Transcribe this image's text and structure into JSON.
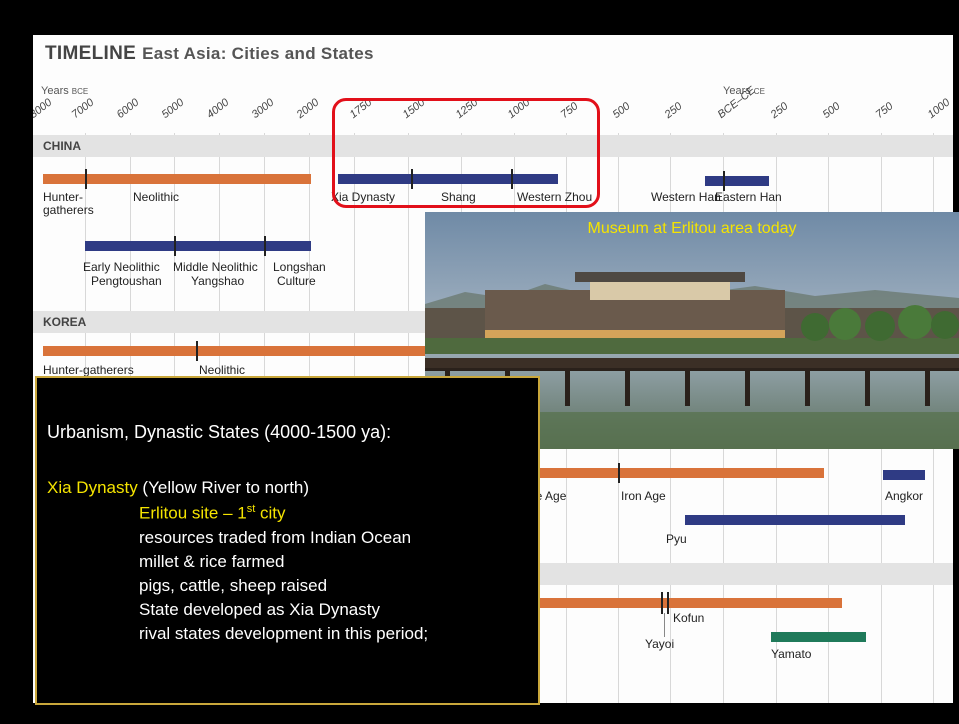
{
  "timeline": {
    "title_main": "TIMELINE",
    "title_sub": "East Asia: Cities and States",
    "years_bce_label": "Years",
    "years_bce_unit": "BCE",
    "years_ce_label": "Years",
    "years_ce_unit": "CE",
    "ticks": [
      "8000",
      "7000",
      "6000",
      "5000",
      "4000",
      "3000",
      "2000",
      "1750",
      "1500",
      "1250",
      "1000",
      "750",
      "500",
      "250",
      "BCE–CE",
      "250",
      "500",
      "750",
      "1000"
    ],
    "regions": {
      "china": "CHINA",
      "korea": "KOREA"
    },
    "labels": {
      "hunter_gatherers": "Hunter-",
      "hunter_gatherers2": "gatherers",
      "neolithic": "Neolithic",
      "xia": "Xia Dynasty",
      "shang": "Shang",
      "western_zhou": "Western Zhou",
      "western_han": "Western Han",
      "eastern_han": "Eastern Han",
      "early_neolithic": "Early Neolithic",
      "pengtoushan": "Pengtoushan",
      "middle_neolithic": "Middle Neolithic",
      "yangshao": "Yangshao",
      "longshan": "Longshan",
      "culture": "Culture",
      "korea_hunter": "Hunter-gatherers",
      "korea_neolithic": "Neolithic",
      "bronze_age": "nze Age",
      "iron_age": "Iron Age",
      "angkor": "Angkor",
      "pyu": "Pyu",
      "kofun": "Kofun",
      "yayoi": "Yayoi",
      "yamato": "Yamato"
    }
  },
  "photo": {
    "caption": "Museum at Erlitou area today"
  },
  "info": {
    "heading": "Urbanism, Dynastic States (4000-1500 ya):",
    "xia": "Xia Dynasty",
    "xia_rest": " (Yellow River to north)",
    "erlitou": "Erlitou site – 1",
    "erlitou_sup": "st",
    "erlitou_end": " city",
    "lines": [
      "resources traded from Indian Ocean",
      "millet & rice farmed",
      "pigs, cattle, sheep raised",
      "State developed as Xia Dynasty",
      "rival states development in this period;"
    ]
  },
  "colors": {
    "orange": "#d9733a",
    "blue": "#2f3b84",
    "green": "#1f7a5a",
    "highlight": "#e2101a",
    "caption_yellow": "#f5e400",
    "box_border": "#c9a73b"
  }
}
